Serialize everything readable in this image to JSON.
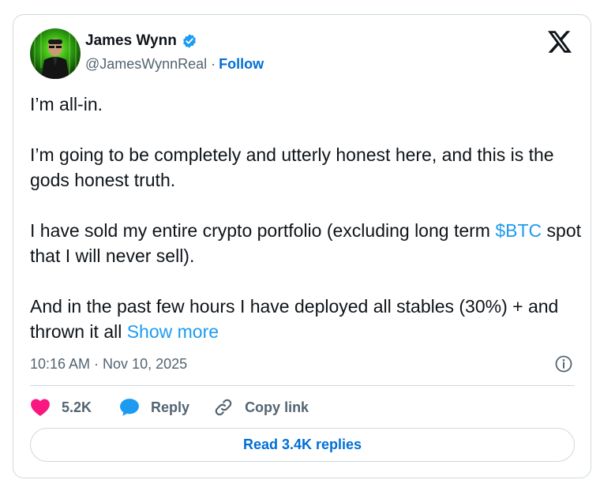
{
  "author": {
    "name": "James Wynn",
    "handle": "@JamesWynnReal",
    "separator": "·",
    "follow_label": "Follow"
  },
  "tweet": {
    "p1": "I’m all-in.",
    "p2": "I’m going to be completely and utterly honest here, and this is the gods honest truth.",
    "p3_before": "I have sold my entire crypto portfolio (excluding long term ",
    "p3_link": "$BTC",
    "p3_after": " spot that I will never sell).",
    "p4": "And in the past few hours I have deployed all stables (30%) + and thrown it all ",
    "show_more": "Show more",
    "timestamp": "10:16 AM · Nov 10, 2025"
  },
  "actions": {
    "likes": "5.2K",
    "reply_label": "Reply",
    "copy_label": "Copy link",
    "read_replies": "Read 3.4K replies"
  },
  "colors": {
    "link": "#1d9bf0",
    "follow": "#006fd6",
    "like": "#f91880",
    "verified": "#1d9bf0"
  },
  "icons": {
    "verified": "verified-badge-icon",
    "logo": "x-logo-icon",
    "info": "info-icon",
    "like": "heart-icon",
    "reply": "reply-bubble-icon",
    "copy": "link-icon"
  }
}
